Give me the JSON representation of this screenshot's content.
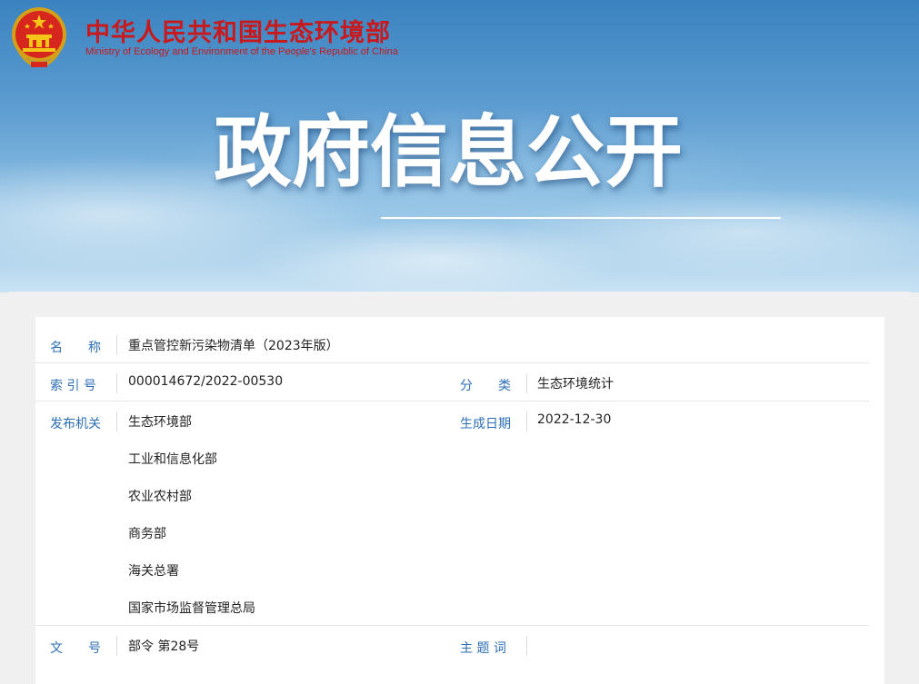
{
  "header": {
    "org_name_cn": "中华人民共和国生态环境部",
    "org_name_en": "Ministry of Ecology and Environment of the People's Republic of China",
    "emblem_icon": "national-emblem-icon"
  },
  "banner": {
    "title": "政府信息公开"
  },
  "info": {
    "name_label": "名　　称",
    "name_value": "重点管控新污染物清单（2023年版）",
    "index_label": "索 引 号",
    "index_value": "000014672/2022-00530",
    "category_label": "分　　类",
    "category_value": "生态环境统计",
    "issuer_label": "发布机关",
    "issuers": [
      "生态环境部",
      "工业和信息化部",
      "农业农村部",
      "商务部",
      "海关总署",
      "国家市场监督管理总局"
    ],
    "date_label": "生成日期",
    "date_value": "2022-12-30",
    "doc_no_label": "文　　号",
    "doc_no_value": "部令 第28号",
    "keywords_label": "主 题 词",
    "keywords_value": ""
  },
  "colors": {
    "title_red": "#c8191d",
    "label_blue": "#2c6fb6"
  }
}
